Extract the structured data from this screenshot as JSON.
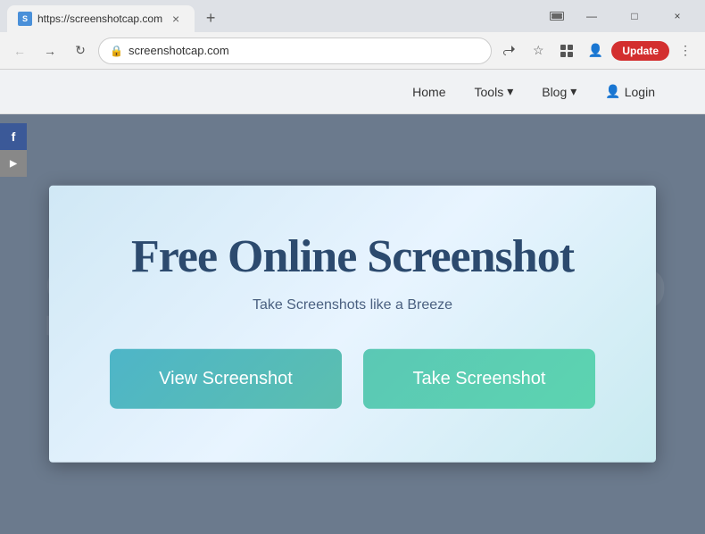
{
  "browser": {
    "tab": {
      "favicon_text": "S",
      "title": "https://screenshotcap.com",
      "close_icon": "×"
    },
    "new_tab_icon": "+",
    "window_controls": {
      "minimize": "—",
      "maximize": "□",
      "close": "×"
    },
    "address_bar": {
      "back_icon": "←",
      "forward_icon": "→",
      "reload_icon": "↻",
      "url": "screenshotcap.com",
      "lock_icon": "🔒",
      "star_icon": "☆",
      "profile_icon": "👤",
      "update_label": "Update",
      "more_icon": "⋮",
      "share_icon": "⬆",
      "extension_icon": "□"
    }
  },
  "website": {
    "nav": {
      "items": [
        {
          "label": "Home",
          "has_dropdown": false
        },
        {
          "label": "Tools",
          "has_dropdown": true
        },
        {
          "label": "Blog",
          "has_dropdown": true
        },
        {
          "label": "Login",
          "has_icon": true
        }
      ]
    },
    "social": {
      "facebook_label": "f",
      "youtube_label": "▶"
    },
    "hero": {
      "title": "Free Online Screenshot",
      "subtitle": "Take Screenshots like a Breeze",
      "view_btn": "View Screenshot",
      "take_btn": "Take Screenshot"
    }
  }
}
